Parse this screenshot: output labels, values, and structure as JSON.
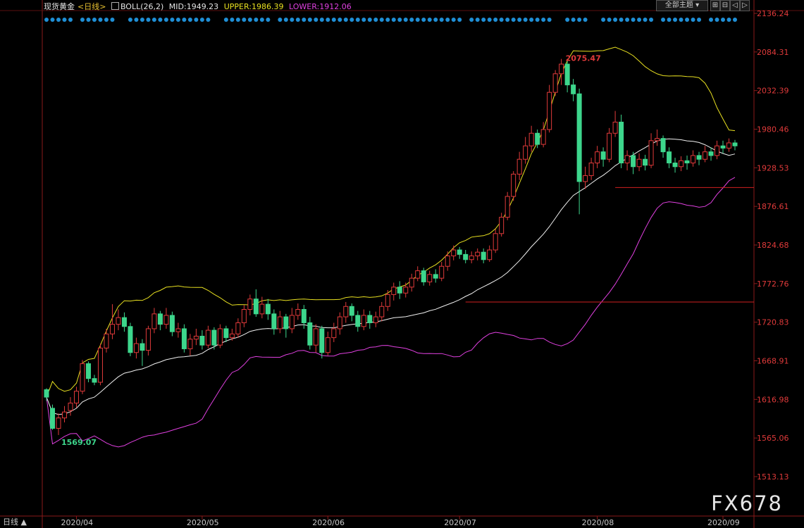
{
  "header": {
    "symbol": "现货黄金",
    "period": "<日线>",
    "indicator": "BOLL(26,2)",
    "mid_label": "MID:1949.23",
    "upper_label": "UPPER:1986.39",
    "lower_label": "LOWER:1912.06"
  },
  "toolbar": {
    "theme_label": "全部主题",
    "buttons": [
      "⊞",
      "⊟",
      "◁",
      "▷",
      "✕"
    ]
  },
  "footer": {
    "period_label": "日线",
    "watermark": "FX678"
  },
  "colors": {
    "up": "#e03a3a",
    "down": "#3dd68c",
    "mid": "#f0f0f0",
    "upper": "#e8e020",
    "lower": "#e040e0",
    "hline": "#d02020",
    "dots": "#1f8fd6",
    "max_label": "#e03a3a",
    "min_label": "#3dd68c"
  },
  "chart_data": {
    "type": "candlestick",
    "ylim": [
      1487.17,
      2136.24
    ],
    "y_ticks": [
      "2136.24",
      "2084.31",
      "2032.39",
      "1980.46",
      "1928.53",
      "1876.61",
      "1824.68",
      "1772.76",
      "1720.83",
      "1668.91",
      "1616.98",
      "1565.06",
      "1513.13"
    ],
    "x_ticks": [
      {
        "label": "2020/04",
        "index": 5
      },
      {
        "label": "2020/05",
        "index": 26
      },
      {
        "label": "2020/06",
        "index": 47
      },
      {
        "label": "2020/07",
        "index": 69
      },
      {
        "label": "2020/08",
        "index": 92
      },
      {
        "label": "2020/09",
        "index": 113
      }
    ],
    "max_label": "2075.47",
    "min_label": "1569.07",
    "horizontal_lines": [
      1748,
      1902
    ],
    "indicator_lines": {
      "mid_value": 1949.23,
      "upper_value": 1986.39,
      "lower_value": 1912.06
    },
    "candles": [
      [
        1630,
        1620,
        1632,
        1615
      ],
      [
        1605,
        1578,
        1610,
        1576
      ],
      [
        1578,
        1592,
        1598,
        1569
      ],
      [
        1592,
        1600,
        1608,
        1586
      ],
      [
        1602,
        1612,
        1620,
        1595
      ],
      [
        1612,
        1628,
        1634,
        1606
      ],
      [
        1628,
        1665,
        1670,
        1624
      ],
      [
        1665,
        1645,
        1668,
        1640
      ],
      [
        1645,
        1640,
        1650,
        1636
      ],
      [
        1640,
        1686,
        1692,
        1636
      ],
      [
        1686,
        1705,
        1712,
        1680
      ],
      [
        1705,
        1718,
        1745,
        1698
      ],
      [
        1718,
        1727,
        1738,
        1710
      ],
      [
        1727,
        1715,
        1734,
        1708
      ],
      [
        1715,
        1680,
        1720,
        1675
      ],
      [
        1680,
        1692,
        1700,
        1672
      ],
      [
        1692,
        1683,
        1698,
        1662
      ],
      [
        1683,
        1712,
        1716,
        1676
      ],
      [
        1712,
        1732,
        1740,
        1706
      ],
      [
        1732,
        1718,
        1736,
        1710
      ],
      [
        1718,
        1730,
        1740,
        1712
      ],
      [
        1730,
        1708,
        1735,
        1702
      ],
      [
        1708,
        1712,
        1720,
        1700
      ],
      [
        1712,
        1685,
        1718,
        1680
      ],
      [
        1685,
        1698,
        1705,
        1676
      ],
      [
        1698,
        1702,
        1712,
        1690
      ],
      [
        1702,
        1690,
        1710,
        1684
      ],
      [
        1690,
        1710,
        1716,
        1686
      ],
      [
        1710,
        1690,
        1714,
        1684
      ],
      [
        1690,
        1712,
        1718,
        1686
      ],
      [
        1712,
        1700,
        1716,
        1694
      ],
      [
        1700,
        1705,
        1712,
        1696
      ],
      [
        1705,
        1720,
        1726,
        1700
      ],
      [
        1720,
        1738,
        1744,
        1714
      ],
      [
        1738,
        1752,
        1758,
        1730
      ],
      [
        1752,
        1732,
        1765,
        1728
      ],
      [
        1732,
        1745,
        1755,
        1726
      ],
      [
        1745,
        1732,
        1752,
        1724
      ],
      [
        1732,
        1712,
        1738,
        1704
      ],
      [
        1712,
        1728,
        1736,
        1706
      ],
      [
        1728,
        1712,
        1732,
        1700
      ],
      [
        1712,
        1730,
        1740,
        1706
      ],
      [
        1730,
        1738,
        1746,
        1724
      ],
      [
        1738,
        1720,
        1744,
        1712
      ],
      [
        1720,
        1690,
        1728,
        1684
      ],
      [
        1690,
        1712,
        1718,
        1680
      ],
      [
        1712,
        1680,
        1716,
        1672
      ],
      [
        1680,
        1700,
        1708,
        1676
      ],
      [
        1700,
        1712,
        1720,
        1694
      ],
      [
        1712,
        1728,
        1734,
        1704
      ],
      [
        1728,
        1742,
        1748,
        1720
      ],
      [
        1742,
        1730,
        1746,
        1722
      ],
      [
        1730,
        1715,
        1736,
        1708
      ],
      [
        1715,
        1730,
        1738,
        1710
      ],
      [
        1730,
        1720,
        1736,
        1712
      ],
      [
        1720,
        1728,
        1735,
        1714
      ],
      [
        1728,
        1742,
        1748,
        1722
      ],
      [
        1742,
        1758,
        1764,
        1736
      ],
      [
        1758,
        1768,
        1774,
        1750
      ],
      [
        1768,
        1760,
        1776,
        1752
      ],
      [
        1760,
        1768,
        1774,
        1754
      ],
      [
        1768,
        1780,
        1786,
        1762
      ],
      [
        1780,
        1790,
        1796,
        1776
      ],
      [
        1790,
        1775,
        1794,
        1770
      ],
      [
        1775,
        1785,
        1790,
        1770
      ],
      [
        1785,
        1780,
        1792,
        1774
      ],
      [
        1780,
        1796,
        1802,
        1776
      ],
      [
        1796,
        1810,
        1816,
        1790
      ],
      [
        1810,
        1818,
        1824,
        1804
      ],
      [
        1818,
        1812,
        1822,
        1806
      ],
      [
        1812,
        1805,
        1818,
        1800
      ],
      [
        1805,
        1810,
        1816,
        1800
      ],
      [
        1810,
        1815,
        1820,
        1804
      ],
      [
        1815,
        1805,
        1820,
        1800
      ],
      [
        1805,
        1818,
        1824,
        1802
      ],
      [
        1818,
        1840,
        1846,
        1814
      ],
      [
        1840,
        1862,
        1868,
        1836
      ],
      [
        1862,
        1890,
        1896,
        1858
      ],
      [
        1890,
        1920,
        1924,
        1884
      ],
      [
        1920,
        1940,
        1950,
        1912
      ],
      [
        1940,
        1958,
        1970,
        1934
      ],
      [
        1958,
        1975,
        1985,
        1950
      ],
      [
        1975,
        1960,
        1980,
        1955
      ],
      [
        1960,
        1980,
        1990,
        1956
      ],
      [
        1980,
        2030,
        2040,
        1976
      ],
      [
        2030,
        2055,
        2060,
        2025
      ],
      [
        2055,
        2068,
        2075,
        2040
      ],
      [
        2068,
        2040,
        2072,
        2030
      ],
      [
        2040,
        2028,
        2048,
        2018
      ],
      [
        2028,
        1910,
        2035,
        1866
      ],
      [
        1910,
        1918,
        1930,
        1900
      ],
      [
        1918,
        1935,
        1942,
        1912
      ],
      [
        1935,
        1950,
        1958,
        1928
      ],
      [
        1950,
        1940,
        1956,
        1930
      ],
      [
        1940,
        1975,
        1982,
        1936
      ],
      [
        1975,
        1990,
        2005,
        1970
      ],
      [
        1990,
        1935,
        2000,
        1928
      ],
      [
        1935,
        1945,
        1952,
        1925
      ],
      [
        1945,
        1930,
        1950,
        1920
      ],
      [
        1930,
        1940,
        1948,
        1924
      ],
      [
        1940,
        1932,
        1946,
        1925
      ],
      [
        1932,
        1965,
        1975,
        1928
      ],
      [
        1965,
        1968,
        1980,
        1958
      ],
      [
        1968,
        1950,
        1972,
        1942
      ],
      [
        1950,
        1935,
        1956,
        1928
      ],
      [
        1935,
        1930,
        1942,
        1922
      ],
      [
        1930,
        1938,
        1944,
        1924
      ],
      [
        1938,
        1935,
        1945,
        1926
      ],
      [
        1935,
        1945,
        1952,
        1930
      ],
      [
        1945,
        1940,
        1950,
        1932
      ],
      [
        1940,
        1950,
        1958,
        1936
      ],
      [
        1950,
        1945,
        1956,
        1938
      ],
      [
        1945,
        1958,
        1965,
        1940
      ],
      [
        1958,
        1955,
        1965,
        1948
      ],
      [
        1955,
        1962,
        1968,
        1950
      ],
      [
        1962,
        1958,
        1966,
        1952
      ]
    ]
  }
}
